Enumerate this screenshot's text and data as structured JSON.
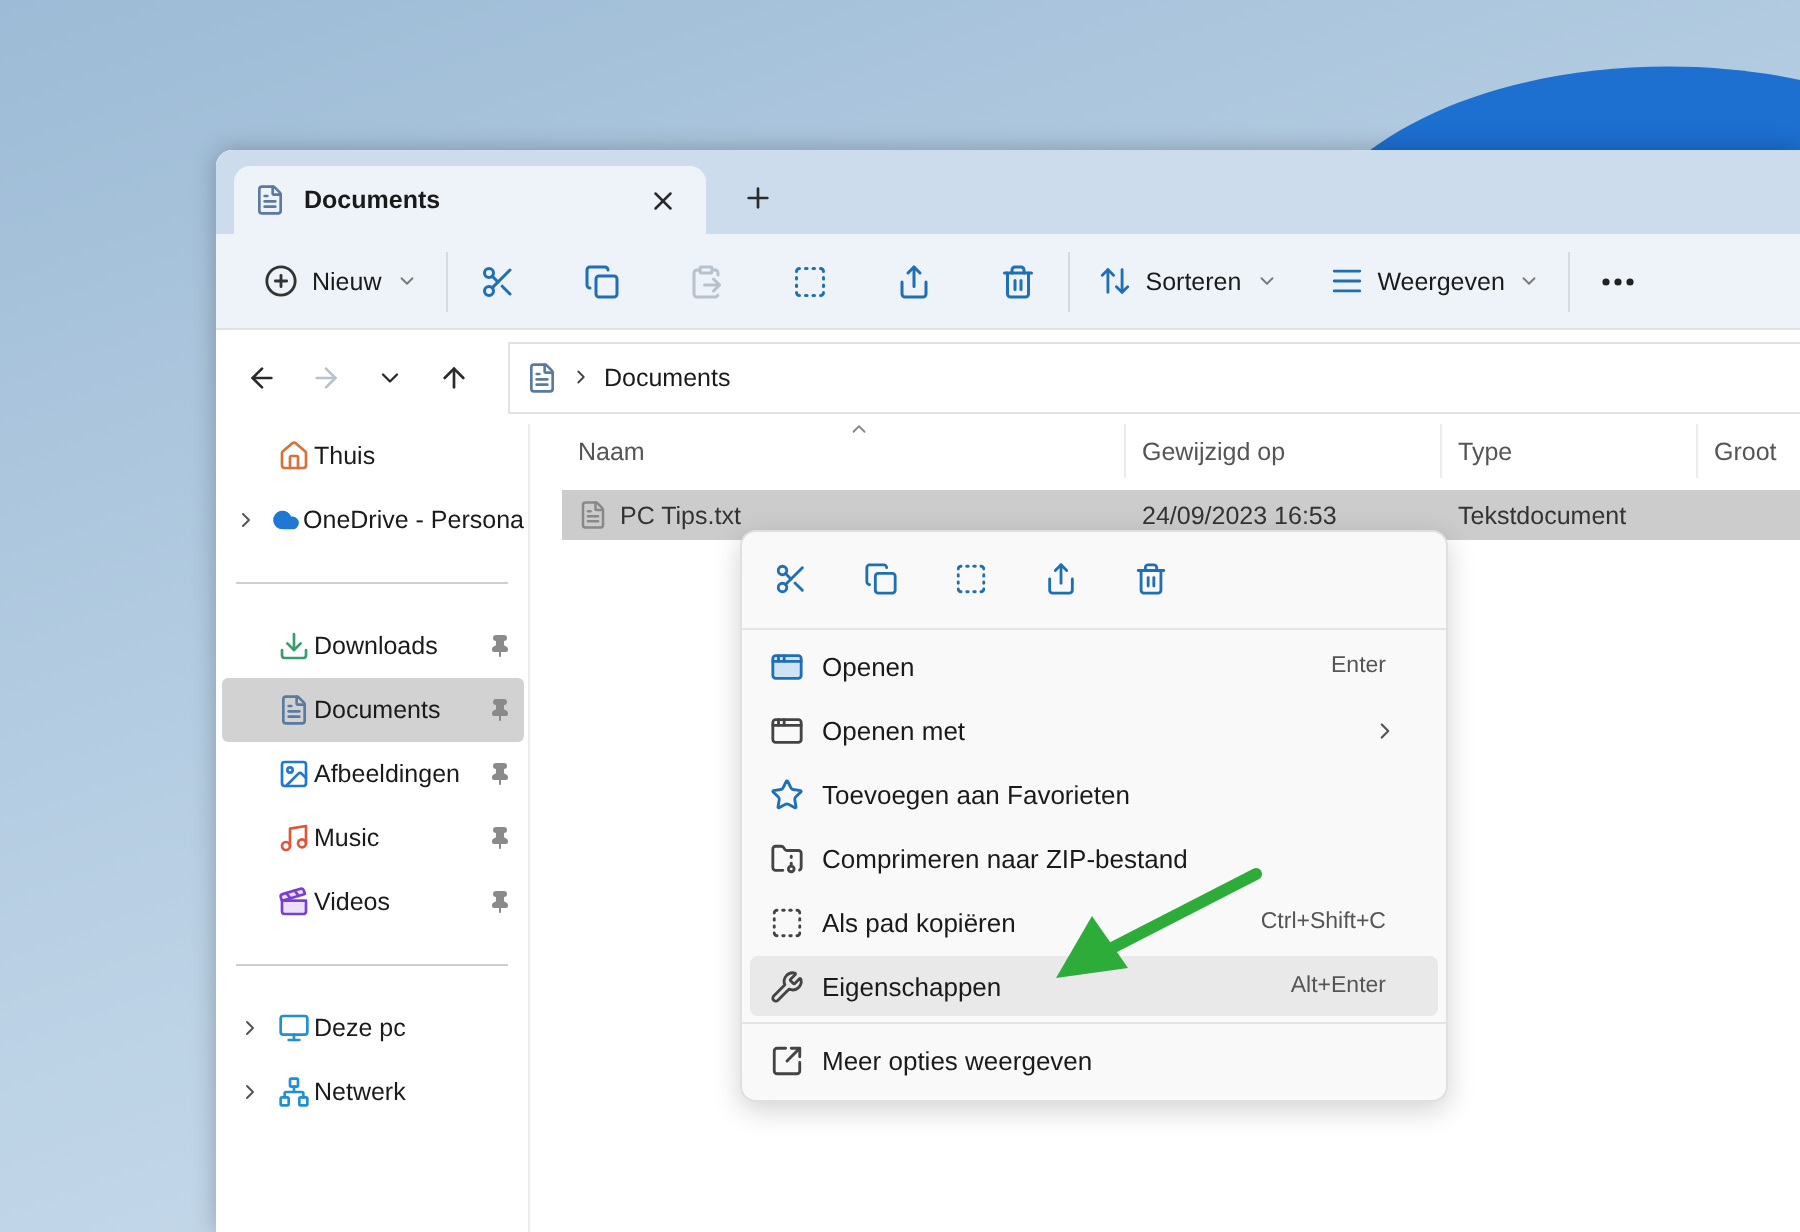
{
  "tab": {
    "title": "Documents",
    "selected": true
  },
  "toolbar": {
    "groups": [
      [
        {
          "kind": "menu",
          "label": "Nieuw",
          "disabled": false
        }
      ],
      [
        {
          "kind": "icon",
          "disabled": false
        },
        {
          "kind": "icon",
          "disabled": false
        },
        {
          "kind": "icon",
          "disabled": true
        },
        {
          "kind": "icon",
          "disabled": false
        },
        {
          "kind": "icon",
          "disabled": false
        },
        {
          "kind": "icon",
          "disabled": false
        }
      ],
      [
        {
          "kind": "menu",
          "label": "Sorteren",
          "disabled": false
        },
        {
          "kind": "menu",
          "label": "Weergeven",
          "disabled": false
        }
      ],
      [
        {
          "kind": "icon",
          "disabled": false
        }
      ]
    ]
  },
  "nav_buttons": [
    {
      "disabled": false
    },
    {
      "disabled": true
    },
    {
      "disabled": false
    },
    {
      "disabled": false
    }
  ],
  "address": {
    "path": [
      "Documents"
    ]
  },
  "sidebar": {
    "sections": [
      [
        {
          "label": "Thuis",
          "expandable": false,
          "pinned": false,
          "selected": false
        },
        {
          "label": "OneDrive - Persona",
          "expandable": true,
          "pinned": false,
          "selected": false
        }
      ],
      [
        {
          "label": "Downloads",
          "expandable": false,
          "pinned": true,
          "selected": false
        },
        {
          "label": "Documents",
          "expandable": false,
          "pinned": true,
          "selected": true
        },
        {
          "label": "Afbeeldingen",
          "expandable": false,
          "pinned": true,
          "selected": false
        },
        {
          "label": "Music",
          "expandable": false,
          "pinned": true,
          "selected": false
        },
        {
          "label": "Videos",
          "expandable": false,
          "pinned": true,
          "selected": false
        }
      ],
      [
        {
          "label": "Deze pc",
          "expandable": true,
          "pinned": false,
          "selected": false
        },
        {
          "label": "Netwerk",
          "expandable": true,
          "pinned": false,
          "selected": false
        }
      ]
    ]
  },
  "table": {
    "columns": [
      "Naam",
      "Gewijzigd op",
      "Type",
      "Groot"
    ],
    "rows": [
      {
        "cells": [
          "PC Tips.txt",
          "24/09/2023 16:53",
          "Tekstdocument"
        ],
        "selected": true
      }
    ]
  },
  "context_menu": {
    "sections": [
      [
        {
          "label": "Openen",
          "shortcut": "Enter",
          "submenu": false,
          "selected": false
        },
        {
          "label": "Openen met",
          "submenu": true,
          "selected": false
        },
        {
          "label": "Toevoegen aan Favorieten",
          "submenu": false,
          "selected": false
        },
        {
          "label": "Comprimeren naar ZIP-bestand",
          "submenu": false,
          "selected": false
        },
        {
          "label": "Als pad kopiëren",
          "shortcut": "Ctrl+Shift+C",
          "submenu": false,
          "selected": false
        },
        {
          "label": "Eigenschappen",
          "shortcut": "Alt+Enter",
          "submenu": false,
          "selected": true
        }
      ],
      [
        {
          "label": "Meer opties weergeven",
          "submenu": false,
          "selected": false
        }
      ]
    ]
  }
}
